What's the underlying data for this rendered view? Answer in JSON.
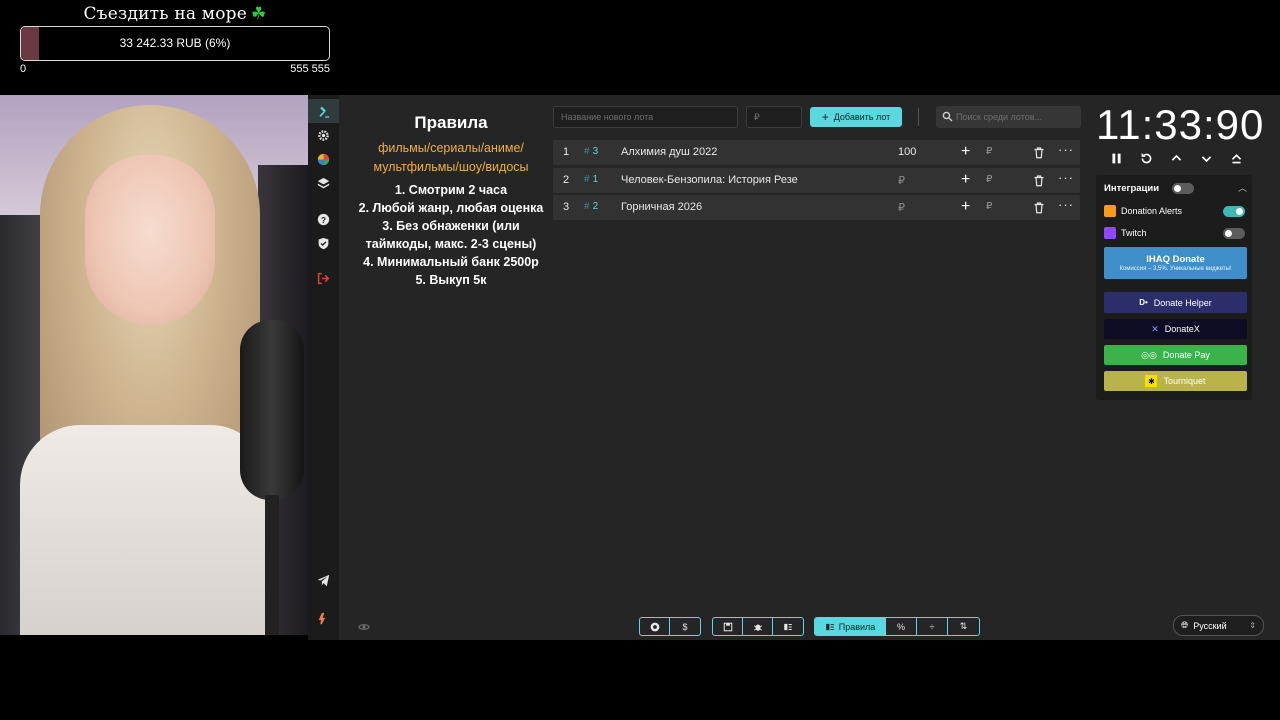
{
  "goal": {
    "title": "Съездить на море",
    "amount_text": "33 242.33 RUB (6%)",
    "min": "0",
    "max": "555 555",
    "progress": 0.06
  },
  "rules": {
    "title": "Правила",
    "genres": [
      "фильмы/сериалы/аниме/",
      "мультфильмы/шоу/видосы"
    ],
    "items": [
      "1. Смотрим 2 часа",
      "2. Любой жанр, любая оценка",
      "3. Без обнаженки (или таймкоды, макс. 2-3 сцены)",
      "4. Минимальный банк 2500р",
      "5. Выкуп 5к"
    ]
  },
  "toolbar": {
    "lot_name_placeholder": "Название нового лота",
    "lot_price_placeholder": "₽",
    "add_lot_label": "Добавить лот",
    "search_placeholder": "Поиск среди лотов..."
  },
  "lots": [
    {
      "num": "1",
      "tag": "3",
      "name": "Алхимия душ 2022",
      "amount": "100"
    },
    {
      "num": "2",
      "tag": "1",
      "name": "Человек-Бензопила: История Резе",
      "amount": "₽"
    },
    {
      "num": "3",
      "tag": "2",
      "name": "Горничная 2026",
      "amount": "₽"
    }
  ],
  "lot_currency": "₽",
  "timer": {
    "value": "11:33:90"
  },
  "integrations": {
    "title": "Интеграции",
    "donation_alerts": "Donation Alerts",
    "twitch": "Twitch",
    "ihaq_title": "IHAQ Donate",
    "ihaq_subtitle": "Комиссия – 3,5%. Уникальные виджеты!",
    "donate_helper": "Donate Helper",
    "donatex": "DonateX",
    "donate_pay": "Donate Pay",
    "tourniquet": "Tourniquet"
  },
  "bottom": {
    "rules_label": "Правила"
  },
  "language": "Русский",
  "colors": {
    "accent": "#5ad7df",
    "panel": "#252525",
    "goal_fill": "#6a3a44",
    "genre_text": "#f0b03c"
  }
}
